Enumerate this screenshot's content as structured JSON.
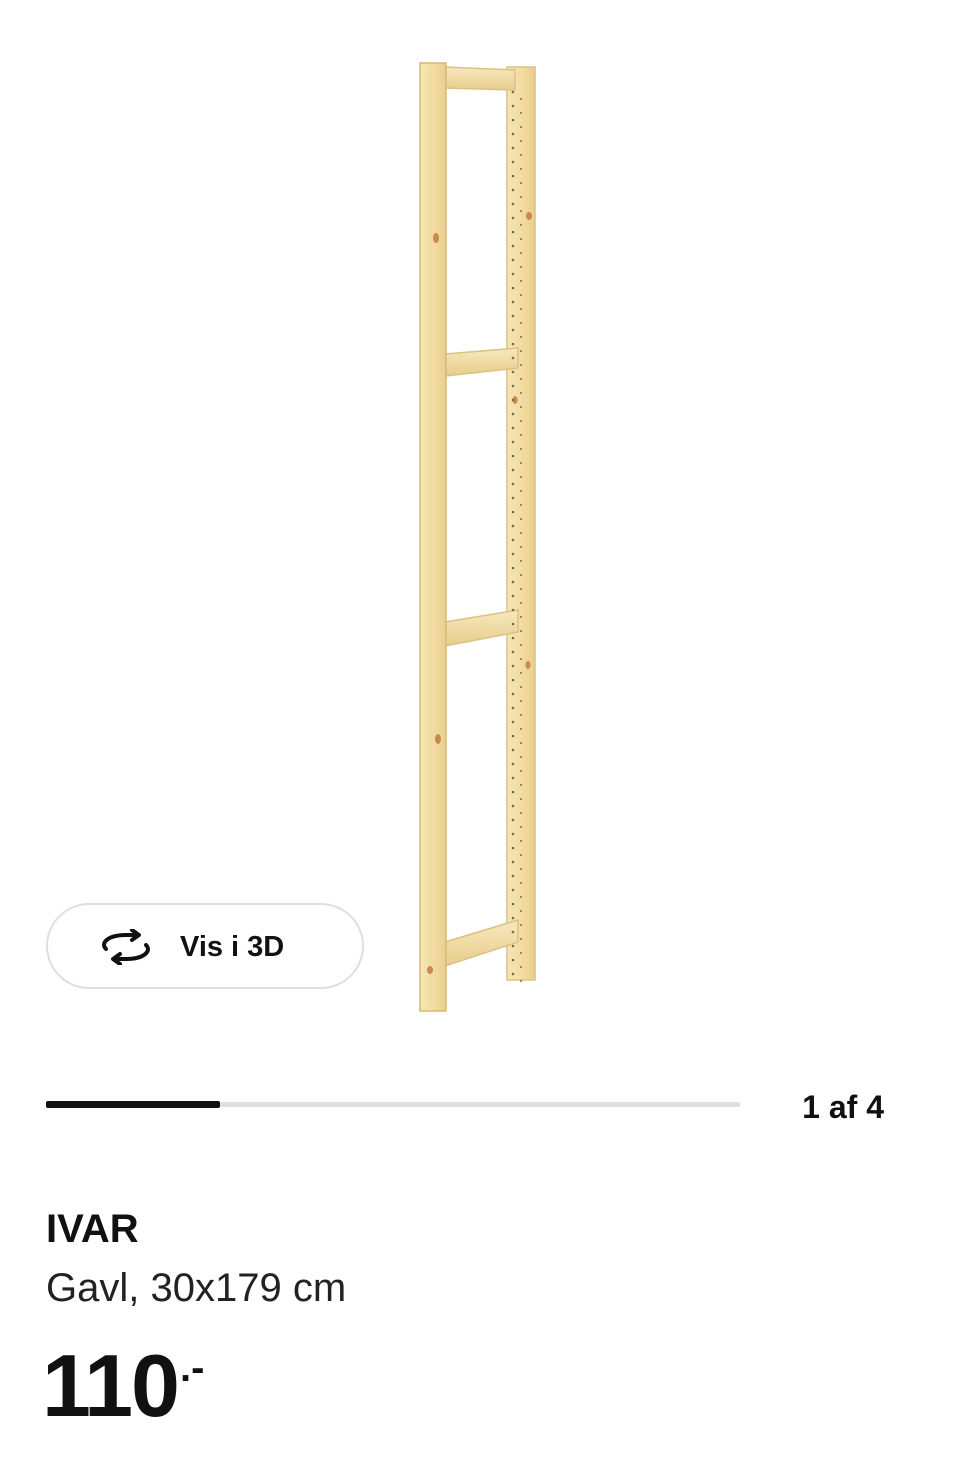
{
  "gallery": {
    "image_alt": "IVAR gavl",
    "view_3d_label": "Vis i 3D",
    "view_3d_icon": "rotate-arrows-icon",
    "progress_fraction": 0.25,
    "counter_text": "1 af 4"
  },
  "product": {
    "name": "IVAR",
    "description": "Gavl, 30x179 cm",
    "price_integer": "110",
    "price_suffix": ".-"
  },
  "colors": {
    "wood": "#f3dfa8",
    "wood_edge": "#d9bd7a",
    "progress_active": "#111111",
    "progress_track": "#dfdfdf"
  }
}
